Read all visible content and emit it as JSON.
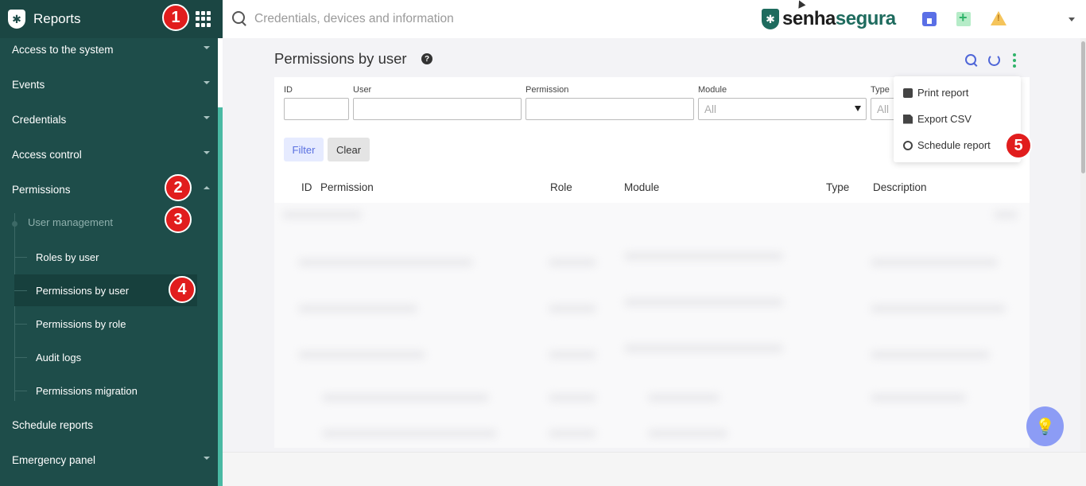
{
  "sidebar": {
    "title": "Reports",
    "items": [
      {
        "label": "Access to the system"
      },
      {
        "label": "Events"
      },
      {
        "label": "Credentials"
      },
      {
        "label": "Access control"
      },
      {
        "label": "Permissions"
      }
    ],
    "subheader": "User management",
    "subitems": [
      {
        "label": "Roles by user"
      },
      {
        "label": "Permissions by user"
      },
      {
        "label": "Permissions by role"
      },
      {
        "label": "Audit logs"
      },
      {
        "label": "Permissions migration"
      }
    ],
    "bottom_items": [
      {
        "label": "Schedule reports"
      },
      {
        "label": "Emergency panel"
      }
    ]
  },
  "topbar": {
    "search_placeholder": "Credentials, devices and information",
    "brand_part1": "senha",
    "brand_part2": "segura"
  },
  "page": {
    "title": "Permissions by user"
  },
  "filters": {
    "id_label": "ID",
    "user_label": "User",
    "permission_label": "Permission",
    "module_label": "Module",
    "module_value": "All",
    "type_label": "Type",
    "type_value": "All",
    "filter_button": "Filter",
    "clear_button": "Clear"
  },
  "table": {
    "columns": [
      "ID",
      "Permission",
      "Role",
      "Module",
      "Type",
      "Description"
    ]
  },
  "dropdown": {
    "items": [
      "Print report",
      "Export CSV",
      "Schedule report"
    ]
  },
  "badges": [
    "1",
    "2",
    "3",
    "4",
    "5"
  ],
  "colors": {
    "sidebar_bg": "#1e4d4a",
    "accent_blue": "#4f66d8",
    "accent_green": "#2fb36a",
    "badge_red": "#e11d1d"
  }
}
